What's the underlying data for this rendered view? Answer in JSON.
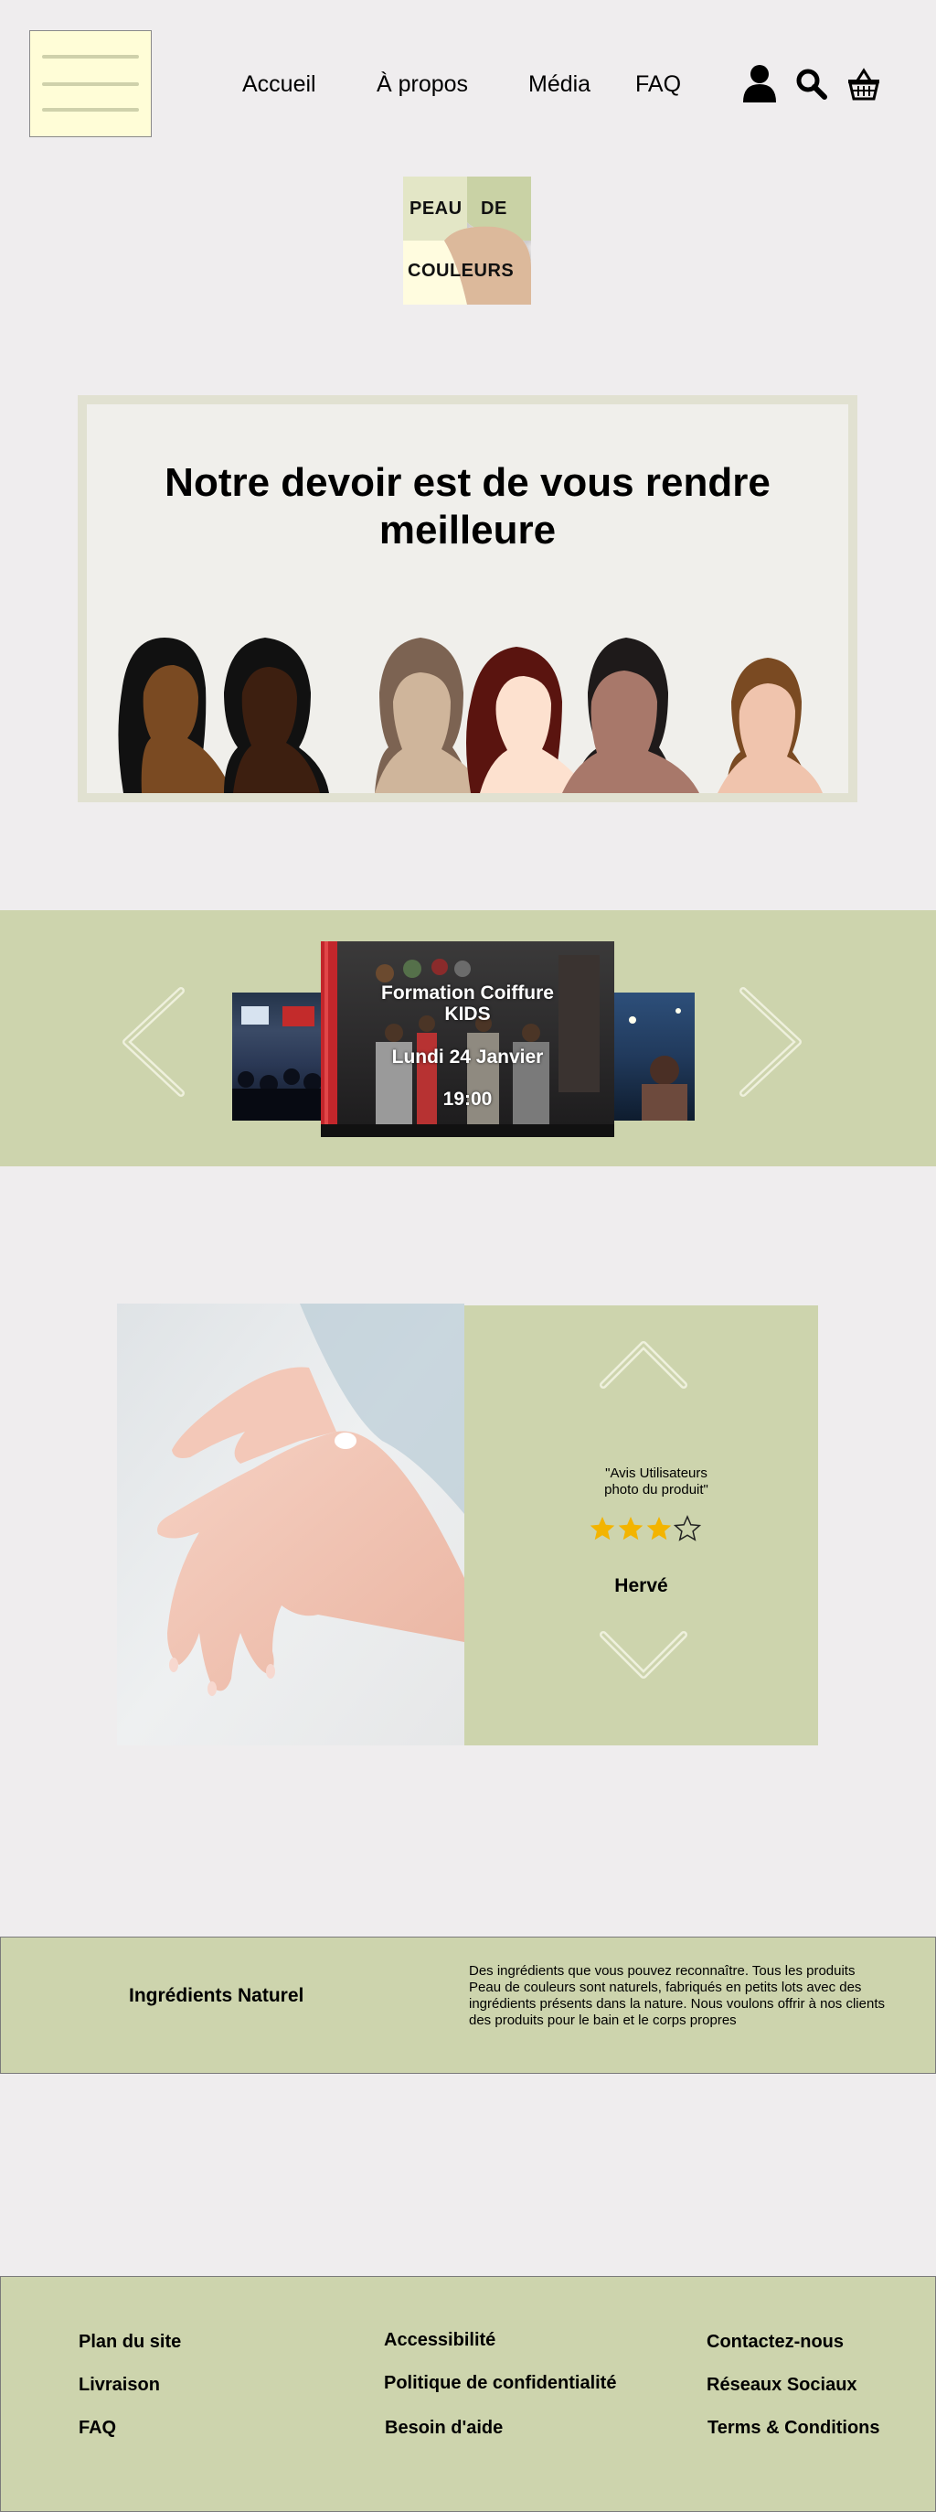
{
  "header": {
    "nav": {
      "accueil": "Accueil",
      "a_propos": "À propos",
      "media": "Média",
      "faq": "FAQ"
    },
    "icons": [
      "menu-icon",
      "user-icon",
      "search-icon",
      "basket-icon"
    ]
  },
  "logo": {
    "line1_left": "PEAU",
    "line1_right": "DE",
    "line2": "COULEURS"
  },
  "hero": {
    "title": "Notre devoir est de vous rendre meilleure"
  },
  "carousel": {
    "event_title": "Formation Coiffure KIDS",
    "event_date": "Lundi 24 Janvier",
    "event_time": "19:00"
  },
  "reviews": {
    "caption": "\"Avis Utilisateurs photo du produit\"",
    "rating": 3,
    "rating_max": 4,
    "reviewer": "Hervé"
  },
  "ingredients": {
    "title": "Ingrédients Naturel",
    "text": "Des ingrédients que vous pouvez reconnaître. Tous les produits Peau de couleurs sont naturels, fabriqués en petits lots avec des ingrédients présents dans la nature. Nous voulons offrir à nos clients des produits pour le bain et le corps propres"
  },
  "footer": {
    "col1": [
      "Plan du site",
      "Livraison",
      "FAQ"
    ],
    "col2": [
      "Accessibilité",
      "Politique de confidentialité",
      "Besoin d'aide"
    ],
    "col3": [
      "Contactez-nous",
      "Réseaux Sociaux",
      "Terms & Conditions"
    ]
  },
  "colors": {
    "page_bg": "#efedee",
    "accent_green": "#cdd4ad",
    "menu_bg": "#fffdd7",
    "star": "#f3b400"
  }
}
